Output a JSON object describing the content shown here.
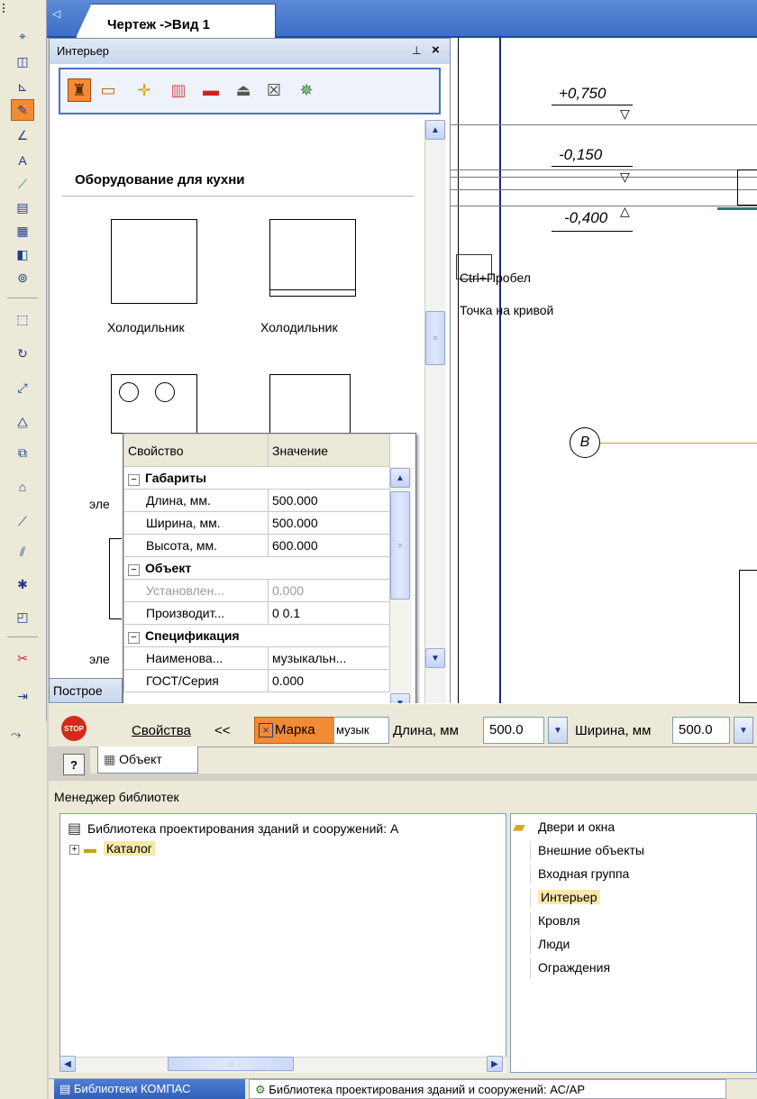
{
  "tab": {
    "doc_title": "Чертеж ->Вид 1"
  },
  "interior_panel": {
    "title": "Интерьер",
    "categories": [
      "chair-icon",
      "table-icon",
      "lamp-icon",
      "sofa-icon",
      "shelf-icon",
      "hat-icon",
      "cat-icon",
      "plant-icon"
    ],
    "section_title": "Оборудование для кухни",
    "items": [
      {
        "label": "Холодильник"
      },
      {
        "label": "Холодильник"
      },
      {
        "label": "эле"
      },
      {
        "label": "эле"
      }
    ]
  },
  "properties": {
    "col_property": "Свойство",
    "col_value": "Значение",
    "groups": [
      {
        "name": "Габариты",
        "rows": [
          {
            "prop": "Длина, мм.",
            "value": "500.000"
          },
          {
            "prop": "Ширина, мм.",
            "value": "500.000"
          },
          {
            "prop": "Высота, мм.",
            "value": "600.000"
          }
        ]
      },
      {
        "name": "Объект",
        "rows": [
          {
            "prop": "Установлен...",
            "value": "0.000"
          },
          {
            "prop": "Производит...",
            "value": "0  0.1"
          }
        ]
      },
      {
        "name": "Спецификация",
        "rows": [
          {
            "prop": "Наименова...",
            "value": "музыкальн..."
          },
          {
            "prop": "ГОСТ/Серия",
            "value": "0.000"
          }
        ]
      }
    ]
  },
  "drawing": {
    "marks": [
      "+0,750",
      "-0,150",
      "-0,400"
    ],
    "hint_key": "Ctrl+Пробел",
    "hint_text": "Точка на кривой",
    "axis_label": "В"
  },
  "propbar": {
    "stop_label": "STOP",
    "properties_label": "Свойства",
    "properties_arrow": "<<",
    "marka_label": "Марка",
    "marka_value": "музык",
    "length_label": "Длина, мм",
    "length_value": "500.0",
    "width_label": "Ширина, мм",
    "width_value": "500.0",
    "object_tab": "Объект",
    "construct_tab": "Построе"
  },
  "library_manager": {
    "title": "Менеджер библиотек",
    "tree_root": "Библиотека проектирования зданий и сооружений: А",
    "tree_child": "Каталог",
    "list": [
      "Двери и окна",
      "Внешние объекты",
      "Входная группа",
      "Интерьер",
      "Кровля",
      "Люди",
      "Ограждения"
    ]
  },
  "bottom_tabs": {
    "tab1": "Библиотеки КОМПАС",
    "tab2": "Библиотека проектирования зданий и сооружений: АС/АР"
  }
}
